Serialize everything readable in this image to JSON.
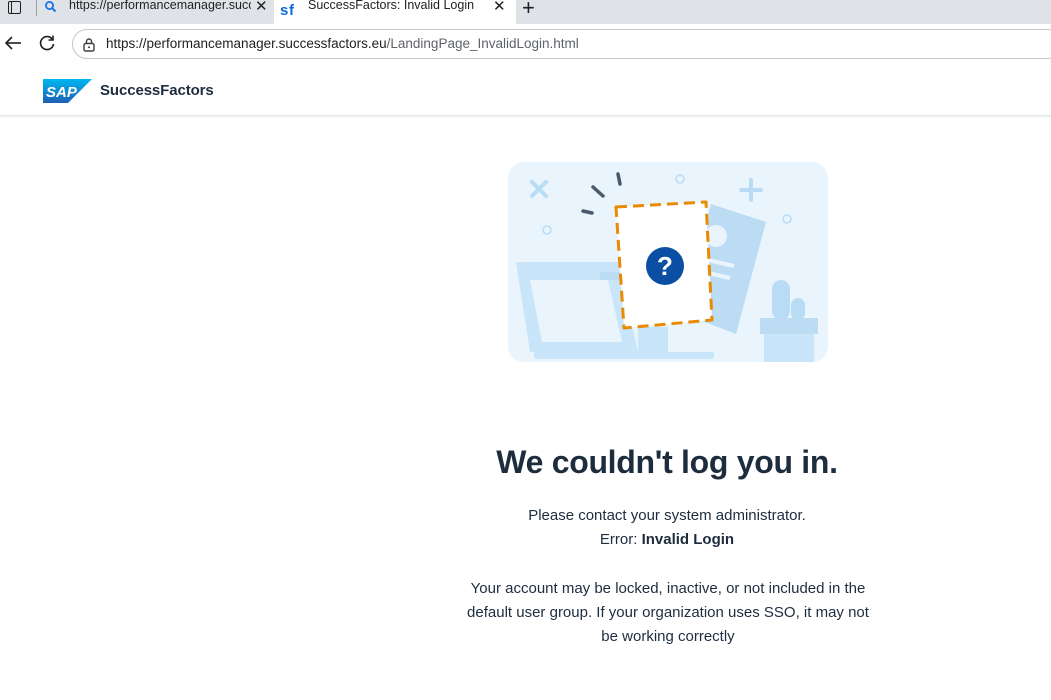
{
  "browser": {
    "tabs": [
      {
        "title": "https://performancemanager.successfactors.eu",
        "favicon": "search-icon",
        "active": false
      },
      {
        "title": "SuccessFactors: Invalid Login",
        "favicon": "sf-icon",
        "active": true
      }
    ],
    "address": {
      "domain": "https://performancemanager.successfactors.eu",
      "path": "/LandingPage_InvalidLogin.html"
    }
  },
  "header": {
    "logo_text": "SAP",
    "brand": "SuccessFactors"
  },
  "main": {
    "heading": "We couldn't log you in.",
    "contact": "Please contact your system administrator.",
    "error_label": "Error:",
    "error_value": "Invalid Login",
    "detail": "Your account may be locked, inactive, or not included in the default user group. If your organization uses SSO, it may not be working correctly"
  },
  "colors": {
    "accent_blue": "#0a4fa3",
    "dashed_orange": "#e98a00",
    "illustration_bg": "#e9f4fd"
  }
}
